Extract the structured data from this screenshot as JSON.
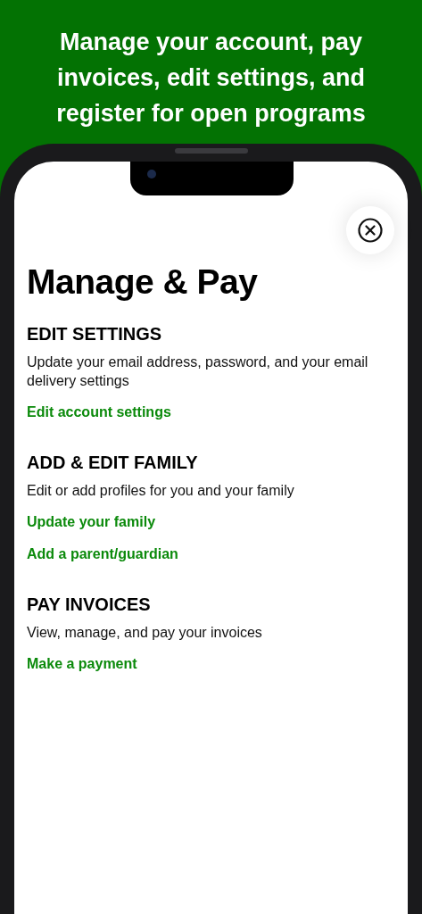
{
  "headline": "Manage your account, pay invoices, edit settings, and register for open programs",
  "page_title": "Manage & Pay",
  "sections": [
    {
      "heading": "EDIT SETTINGS",
      "description": "Update your email address, password, and your email delivery settings",
      "links": [
        "Edit account settings"
      ]
    },
    {
      "heading": "ADD & EDIT FAMILY",
      "description": "Edit or add profiles for you and your family",
      "links": [
        "Update your family",
        "Add a parent/guardian"
      ]
    },
    {
      "heading": "PAY INVOICES",
      "description": "View, manage, and pay your invoices",
      "links": [
        "Make a payment"
      ]
    }
  ]
}
